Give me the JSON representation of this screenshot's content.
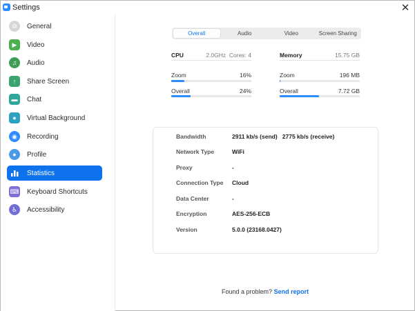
{
  "window": {
    "title": "Settings"
  },
  "sidebar": {
    "items": [
      {
        "label": "General",
        "icon": "gear-icon",
        "color": "#d6d6d6"
      },
      {
        "label": "Video",
        "icon": "video-camera-icon",
        "color": "#4caf50"
      },
      {
        "label": "Audio",
        "icon": "headphones-icon",
        "color": "#3d9c56"
      },
      {
        "label": "Share Screen",
        "icon": "share-screen-icon",
        "color": "#3aa46f"
      },
      {
        "label": "Chat",
        "icon": "chat-bubble-icon",
        "color": "#2fa89a"
      },
      {
        "label": "Virtual Background",
        "icon": "person-background-icon",
        "color": "#2aa2c0"
      },
      {
        "label": "Recording",
        "icon": "record-icon",
        "color": "#2d8cff"
      },
      {
        "label": "Profile",
        "icon": "profile-icon",
        "color": "#4a9ae8"
      },
      {
        "label": "Statistics",
        "icon": "bar-chart-icon",
        "color": "#ffffff"
      },
      {
        "label": "Keyboard Shortcuts",
        "icon": "keyboard-icon",
        "color": "#7e6fd6"
      },
      {
        "label": "Accessibility",
        "icon": "accessibility-icon",
        "color": "#6f6fd6"
      }
    ],
    "active_index": 8
  },
  "tabs": [
    "Overall",
    "Audio",
    "Video",
    "Screen Sharing"
  ],
  "cpu": {
    "title": "CPU",
    "info": "2.0GHz  Cores: 4",
    "rows": [
      {
        "label": "Zoom",
        "value": "16%",
        "fraction": 0.16
      },
      {
        "label": "Overall",
        "value": "24%",
        "fraction": 0.24
      }
    ]
  },
  "memory": {
    "title": "Memory",
    "info": "15.75 GB",
    "rows": [
      {
        "label": "Zoom",
        "value": "196 MB",
        "fraction": 0.012
      },
      {
        "label": "Overall",
        "value": "7.72 GB",
        "fraction": 0.49
      }
    ]
  },
  "info": [
    {
      "label": "Bandwidth",
      "value": "2911 kb/s (send)   2775 kb/s (receive)"
    },
    {
      "label": "Network Type",
      "value": "WiFi"
    },
    {
      "label": "Proxy",
      "value": "-"
    },
    {
      "label": "Connection Type",
      "value": "Cloud"
    },
    {
      "label": "Data Center",
      "value": "-"
    },
    {
      "label": "Encryption",
      "value": "AES-256-ECB"
    },
    {
      "label": "Version",
      "value": "5.0.0 (23168.0427)"
    }
  ],
  "footer": {
    "text": "Found a problem?",
    "link": "Send report"
  },
  "colors": {
    "accent": "#0e72ed",
    "bar": "#2d8cff"
  }
}
